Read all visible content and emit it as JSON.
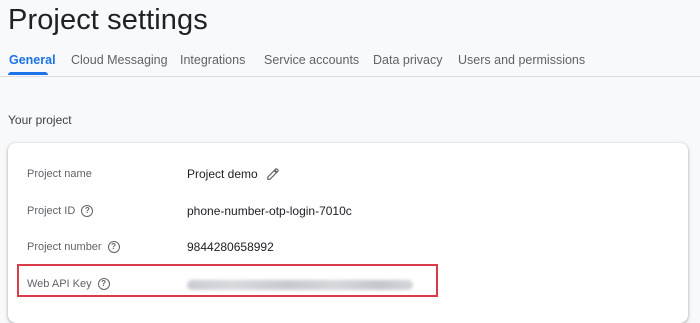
{
  "page": {
    "title": "Project settings"
  },
  "tabs": [
    {
      "label": "General",
      "active": true
    },
    {
      "label": "Cloud Messaging",
      "active": false
    },
    {
      "label": "Integrations",
      "active": false
    },
    {
      "label": "Service accounts",
      "active": false
    },
    {
      "label": "Data privacy",
      "active": false
    },
    {
      "label": "Users and permissions",
      "active": false
    }
  ],
  "section": {
    "title": "Your project"
  },
  "project": {
    "name_label": "Project name",
    "name_value": "Project demo",
    "id_label": "Project ID",
    "id_value": "phone-number-otp-login-7010c",
    "number_label": "Project number",
    "number_value": "9844280658992",
    "api_key_label": "Web API Key"
  },
  "colors": {
    "accent": "#1a73e8",
    "highlight": "#d93b4a"
  },
  "icons": {
    "edit": "pencil-icon",
    "help": "question-circle-icon"
  }
}
